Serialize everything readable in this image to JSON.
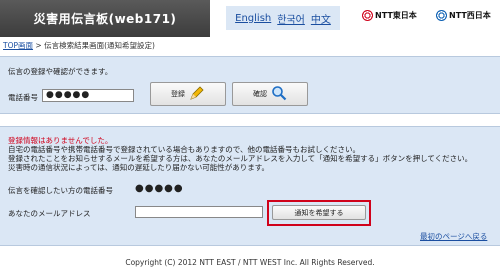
{
  "header": {
    "title": "災害用伝言板(web171)",
    "languages": [
      "English",
      "한국어",
      "中文"
    ],
    "ntt_east": "NTT東日本",
    "ntt_west": "NTT西日本"
  },
  "breadcrumb": {
    "top_link": "TOP画面",
    "separator": ">",
    "current": "伝言検索結果画面(通知希望設定)"
  },
  "register_panel": {
    "intro": "伝言の登録や確認ができます。",
    "phone_label": "電話番号",
    "phone_value": "●●●●●",
    "register_button": "登録",
    "confirm_button": "確認"
  },
  "result_panel": {
    "no_info": "登録情報はありませんでした。",
    "line1": "自宅の電話番号や携帯電話番号で登録されている場合もありますので、他の電話番号もお試しください。",
    "line2": "登録されたことをお知らせするメールを希望する方は、あなたのメールアドレスを入力して「通知を希望する」ボタンを押してください。",
    "line3": "災害時の通信状況によっては、通知の遅延したり届かない可能性があります。",
    "check_phone_label": "伝言を確認したい方の電話番号",
    "check_phone_value": "●●●●●",
    "email_label": "あなたのメールアドレス",
    "email_value": "",
    "notify_button": "通知を希望する",
    "back_link": "最初のページへ戻る"
  },
  "footer": {
    "copyright": "Copyright (C) 2012 NTT EAST / NTT WEST Inc. All Rights Reserved."
  },
  "colors": {
    "panel_bg": "#dbe7f5",
    "title_bg": "#4a4a4a",
    "alert_red": "#d0021b",
    "link_blue": "#1a4ea0"
  }
}
